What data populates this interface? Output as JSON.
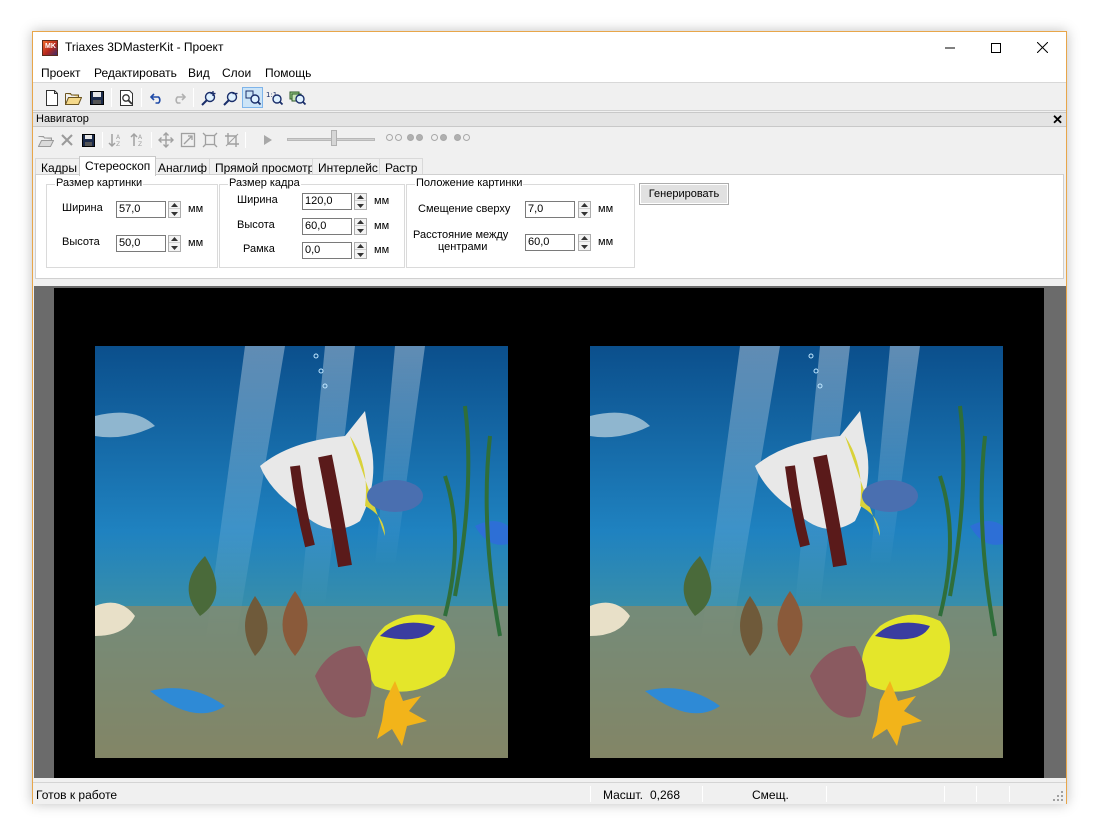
{
  "window": {
    "title": "Triaxes 3DMasterKit - Проект",
    "icon_text": "MK",
    "accent_border": "#e8a64a"
  },
  "menu": {
    "items": [
      "Проект",
      "Редактировать",
      "Вид",
      "Слои",
      "Помощь"
    ]
  },
  "toolbar": {
    "icons": [
      "new-document-icon",
      "open-folder-icon",
      "save-icon",
      "print-preview-icon",
      "undo-icon",
      "redo-icon",
      "zoom-in-icon",
      "zoom-out-icon",
      "zoom-fit-icon",
      "zoom-actual-icon",
      "zoom-layer-icon"
    ],
    "active": "zoom-fit-icon"
  },
  "navigator": {
    "title": "Навигатор",
    "close_glyph": "✕"
  },
  "tabs": [
    {
      "label": "Кадры",
      "active": false
    },
    {
      "label": "Стереоскоп",
      "active": true
    },
    {
      "label": "Анаглиф",
      "active": false
    },
    {
      "label": "Прямой просмотр",
      "active": false
    },
    {
      "label": "Интерлейс",
      "active": false
    },
    {
      "label": "Растр",
      "active": false
    }
  ],
  "stereo": {
    "image_size": {
      "title": "Размер картинки",
      "width_label": "Ширина",
      "width_value": "57,0",
      "height_label": "Высота",
      "height_value": "50,0",
      "unit": "мм"
    },
    "frame_size": {
      "title": "Размер кадра",
      "width_label": "Ширина",
      "width_value": "120,0",
      "height_label": "Высота",
      "height_value": "60,0",
      "border_label": "Рамка",
      "border_value": "0,0",
      "unit": "мм"
    },
    "position": {
      "title": "Положение картинки",
      "offset_label": "Смещение сверху",
      "offset_value": "7,0",
      "distance_label_1": "Расстояние между",
      "distance_label_2": "центрами",
      "distance_value": "60,0",
      "unit": "мм"
    },
    "generate_label": "Генерировать"
  },
  "status": {
    "ready": "Готов к работе",
    "scale_label": "Масшт.",
    "scale_value": "0,268",
    "offset_label": "Смещ."
  },
  "colors": {
    "water_top": "#0a4e8a",
    "water_mid": "#1d7fbf",
    "sand": "#8b8a6a",
    "selection": "#cce4f7"
  }
}
